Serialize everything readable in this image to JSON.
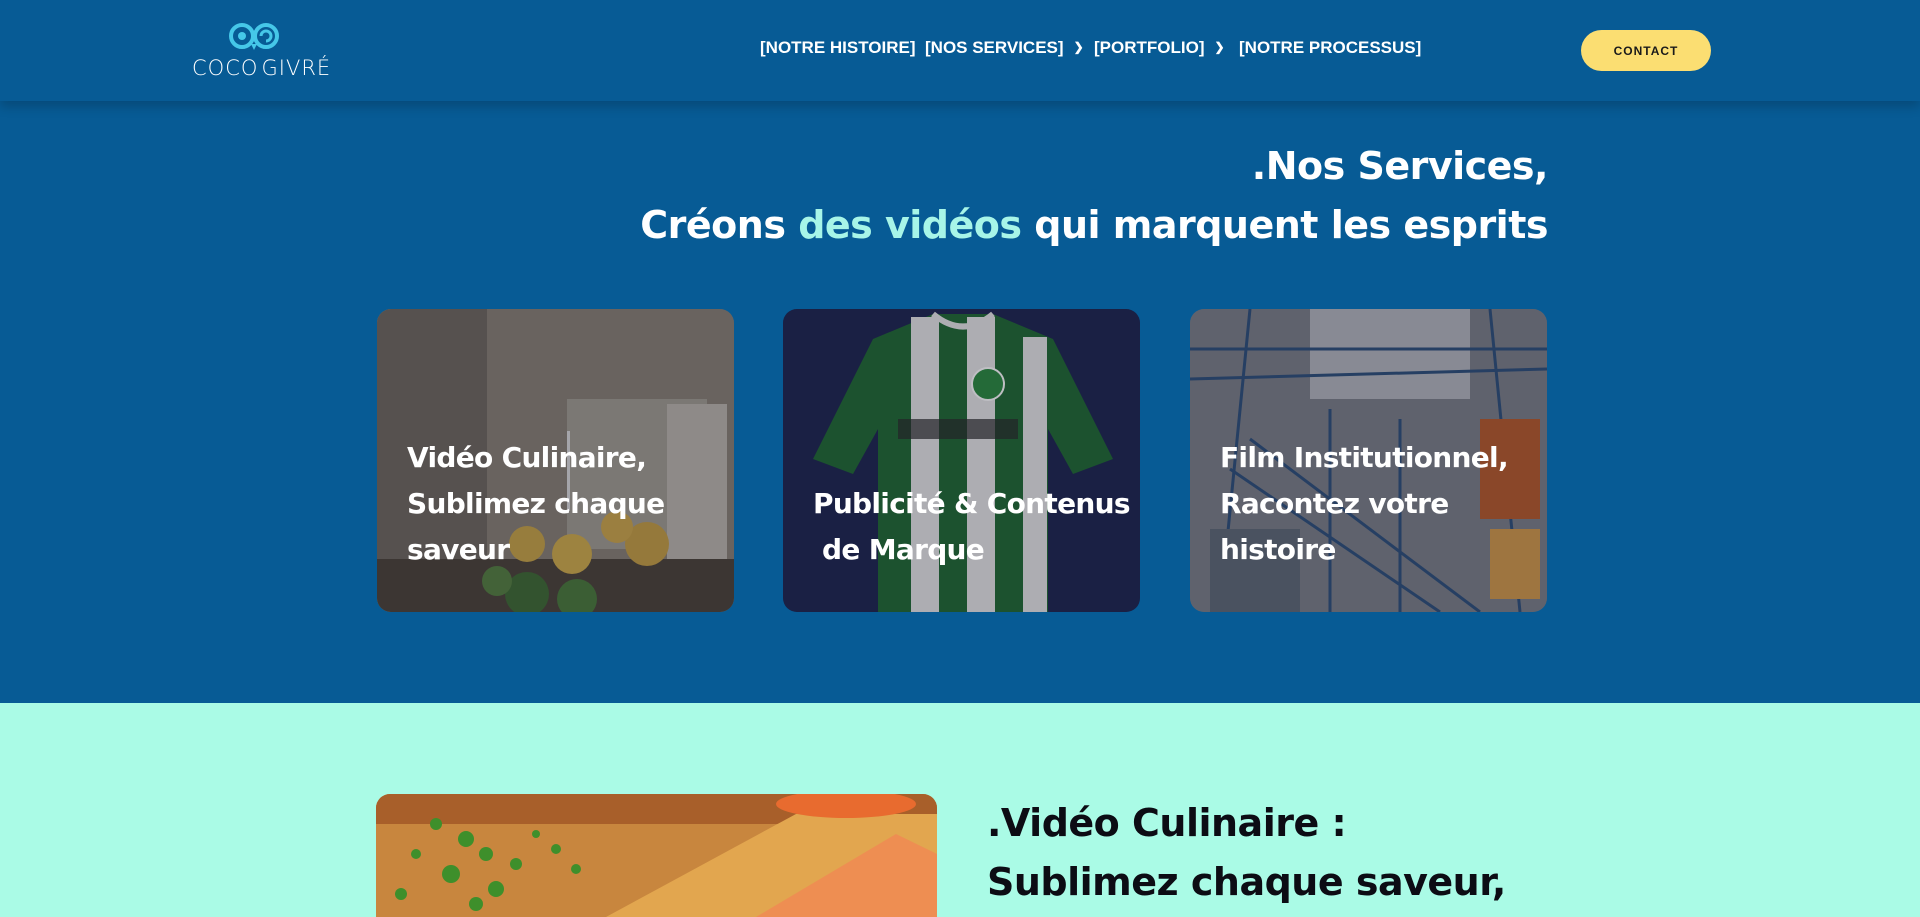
{
  "brand": {
    "logo_left": "COCO",
    "logo_right": "GIVRÉ",
    "accent_color": "#45c7e8"
  },
  "nav": {
    "items": [
      {
        "label": "[NOTRE HISTOIRE]",
        "has_dropdown": false
      },
      {
        "label": "[NOS SERVICES]",
        "has_dropdown": true
      },
      {
        "label": "[PORTFOLIO]",
        "has_dropdown": true
      },
      {
        "label": "[NOTRE PROCESSUS]",
        "has_dropdown": false
      }
    ],
    "dropdown_icon": "chevron-down-icon",
    "contact_label": "CONTACT"
  },
  "hero": {
    "line1": ".Nos Services,",
    "line2_a": "Créons ",
    "line2_accent": "des vidéos",
    "line2_b": " qui marquent les esprits"
  },
  "cards": [
    {
      "line1": "Vidéo Culinaire,",
      "line2": "Sublimez chaque",
      "line3": "saveur"
    },
    {
      "line1": "Publicité & Contenus",
      "line2": " de Marque"
    },
    {
      "line1": "Film Institutionnel,",
      "line2": "Racontez votre",
      "line3": "histoire"
    }
  ],
  "section": {
    "title_line1": ".Vidéo Culinaire :",
    "title_line2": "Sublimez chaque saveur,"
  },
  "colors": {
    "primary_blue": "#075b95",
    "mint": "#aafbe6",
    "cta_yellow": "#fbde72",
    "accent_text": "#a7f5e8"
  }
}
